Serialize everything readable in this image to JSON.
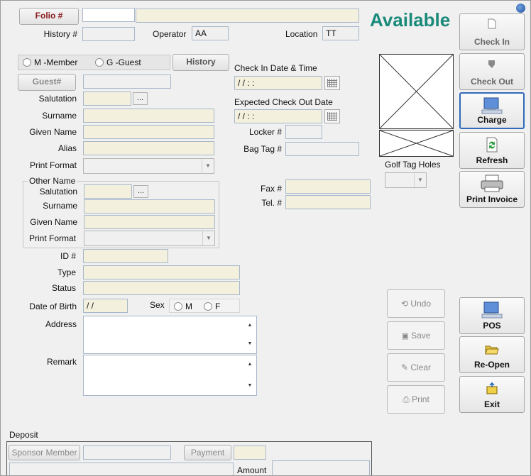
{
  "header": {
    "folio_btn": "Folio #",
    "status": "Available",
    "history_no_label": "History #",
    "operator_label": "Operator",
    "operator_value": "AA",
    "location_label": "Location",
    "location_value": "TT"
  },
  "member_type": {
    "member_label": "M -Member",
    "guest_label": "G -Guest",
    "history_btn": "History"
  },
  "guest": {
    "guest_btn": "Guest#",
    "salutation": "Salutation",
    "surname": "Surname",
    "given_name": "Given Name",
    "alias": "Alias",
    "print_format": "Print Format",
    "dots": "..."
  },
  "other_name": {
    "title": "Other Name",
    "salutation": "Salutation",
    "surname": "Surname",
    "given_name": "Given Name",
    "print_format": "Print Format",
    "dots": "..."
  },
  "details": {
    "id": "ID #",
    "type": "Type",
    "status": "Status",
    "dob": "Date of Birth",
    "dob_value": " / /",
    "sex": "Sex",
    "sex_m": "M",
    "sex_f": "F",
    "address": "Address",
    "remark": "Remark"
  },
  "checkin": {
    "checkin_label": "Check In Date & Time",
    "checkin_value": " / /    : :",
    "checkout_label": "Expected Check Out Date",
    "checkout_value": " / /    : :",
    "locker": "Locker #",
    "bagtag": "Bag Tag #",
    "fax": "Fax #",
    "tel": "Tel. #"
  },
  "golf": {
    "golf_tag_holes": "Golf Tag Holes"
  },
  "actions": {
    "check_in": "Check In",
    "check_out": "Check Out",
    "charge": "Charge",
    "refresh": "Refresh",
    "print_invoice": "Print Invoice",
    "undo": "Undo",
    "save": "Save",
    "clear": "Clear",
    "print": "Print",
    "pos": "POS",
    "reopen": "Re-Open",
    "exit": "Exit"
  },
  "deposit": {
    "title": "Deposit",
    "sponsor_member": "Sponsor Member",
    "payment": "Payment",
    "amount": "Amount"
  },
  "colors": {
    "accent": "#1a8a7a",
    "folio_text": "#8b1a1a",
    "field_yellow": "#f3f0de"
  }
}
